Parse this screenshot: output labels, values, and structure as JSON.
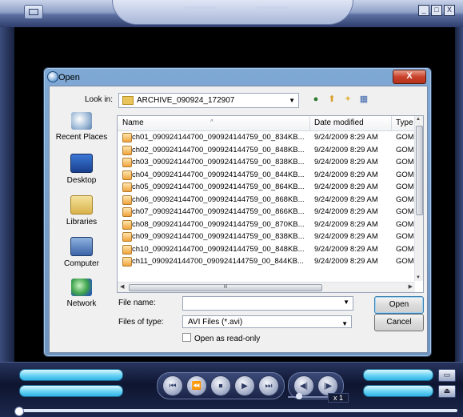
{
  "player": {
    "window_buttons": [
      "_",
      "□",
      "X"
    ],
    "speed_label": "x 1",
    "controls": [
      "⏮",
      "⏪",
      "⏹",
      "▶",
      "⏭",
      "◀|",
      "|▶"
    ],
    "control_icons": [
      "prev-icon",
      "rewind-icon",
      "stop-icon",
      "play-icon",
      "next-icon",
      "frame-back-icon",
      "frame-forward-icon"
    ],
    "side_icons": [
      "open-folder-icon",
      "eject-icon"
    ]
  },
  "dialog": {
    "title": "Open",
    "close_label": "X",
    "look_in_label": "Look in:",
    "look_in_value": "ARCHIVE_090924_172907",
    "places": [
      {
        "label": "Recent Places",
        "icon": "recent-places-icon"
      },
      {
        "label": "Desktop",
        "icon": "desktop-icon"
      },
      {
        "label": "Libraries",
        "icon": "libraries-icon"
      },
      {
        "label": "Computer",
        "icon": "computer-icon"
      },
      {
        "label": "Network",
        "icon": "network-icon"
      }
    ],
    "columns": {
      "name": "Name",
      "date": "Date modified",
      "type": "Type"
    },
    "files": [
      {
        "name": "ch01_090924144700_090924144759_00_834KB...",
        "date": "9/24/2009 8:29 AM",
        "type": "GOM I"
      },
      {
        "name": "ch02_090924144700_090924144759_00_848KB...",
        "date": "9/24/2009 8:29 AM",
        "type": "GOM I"
      },
      {
        "name": "ch03_090924144700_090924144759_00_838KB...",
        "date": "9/24/2009 8:29 AM",
        "type": "GOM I"
      },
      {
        "name": "ch04_090924144700_090924144759_00_844KB...",
        "date": "9/24/2009 8:29 AM",
        "type": "GOM I"
      },
      {
        "name": "ch05_090924144700_090924144759_00_864KB...",
        "date": "9/24/2009 8:29 AM",
        "type": "GOM I"
      },
      {
        "name": "ch06_090924144700_090924144759_00_868KB...",
        "date": "9/24/2009 8:29 AM",
        "type": "GOM I"
      },
      {
        "name": "ch07_090924144700_090924144759_00_866KB...",
        "date": "9/24/2009 8:29 AM",
        "type": "GOM I"
      },
      {
        "name": "ch08_090924144700_090924144759_00_870KB...",
        "date": "9/24/2009 8:29 AM",
        "type": "GOM I"
      },
      {
        "name": "ch09_090924144700_090924144759_00_838KB...",
        "date": "9/24/2009 8:29 AM",
        "type": "GOM I"
      },
      {
        "name": "ch10_090924144700_090924144759_00_848KB...",
        "date": "9/24/2009 8:29 AM",
        "type": "GOM I"
      },
      {
        "name": "ch11_090924144700_090924144759_00_844KB...",
        "date": "9/24/2009 8:29 AM",
        "type": "GOM I"
      }
    ],
    "hscroll_grip": "III",
    "file_name_label": "File name:",
    "file_name_value": "",
    "files_of_type_label": "Files of type:",
    "files_of_type_value": "AVI Files (*.avi)",
    "read_only_label": "Open as read-only",
    "open_label": "Open",
    "cancel_label": "Cancel"
  }
}
